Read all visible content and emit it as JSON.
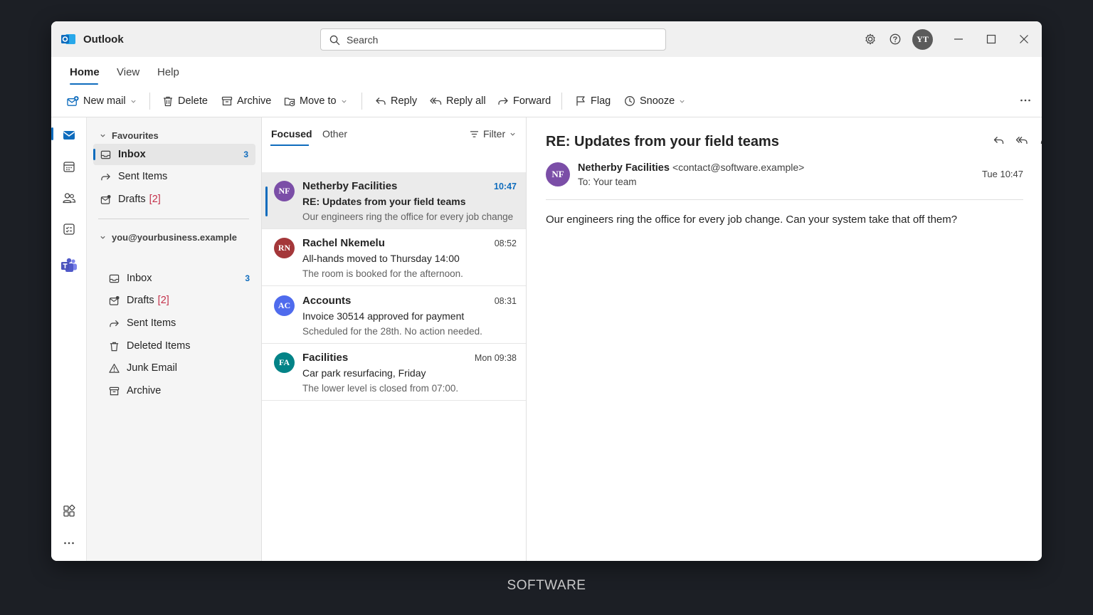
{
  "app": {
    "name": "Outlook",
    "user_initials": "YT",
    "accent_color": "#0f6cbd"
  },
  "search": {
    "placeholder": "Search"
  },
  "ribbon": {
    "tabs": [
      {
        "label": "Home",
        "active": true
      },
      {
        "label": "View",
        "active": false
      },
      {
        "label": "Help",
        "active": false
      }
    ],
    "commands": {
      "new_mail": "New mail",
      "delete": "Delete",
      "archive": "Archive",
      "move_to": "Move to",
      "reply": "Reply",
      "reply_all": "Reply all",
      "forward": "Forward",
      "flag": "Flag",
      "snooze": "Snooze"
    }
  },
  "folders": {
    "favourites": {
      "title": "Favourites",
      "items": [
        {
          "label": "Inbox",
          "count": "3",
          "icon": "inbox-icon",
          "selected": true
        },
        {
          "label": "Sent Items",
          "icon": "send-icon"
        },
        {
          "label": "Drafts",
          "bracket": "[2]",
          "icon": "drafts-icon"
        }
      ]
    },
    "account": {
      "title": "you@yourbusiness.example",
      "items": [
        {
          "label": "Inbox",
          "count": "3",
          "icon": "inbox-icon"
        },
        {
          "label": "Drafts",
          "bracket": "[2]",
          "icon": "drafts-icon"
        },
        {
          "label": "Sent Items",
          "icon": "send-icon"
        },
        {
          "label": "Deleted Items",
          "icon": "trash-icon"
        },
        {
          "label": "Junk Email",
          "icon": "warning-icon"
        },
        {
          "label": "Archive",
          "icon": "archive-icon"
        }
      ]
    }
  },
  "message_list": {
    "tabs": {
      "focused": "Focused",
      "other": "Other"
    },
    "filter_label": "Filter",
    "messages": [
      {
        "initials": "NF",
        "avatar_color": "#7b4ea7",
        "sender": "Netherby Facilities",
        "time": "10:47",
        "subject": "RE: Updates from your field teams",
        "preview": "Our engineers ring the office for every job change. Can your system take that off them?",
        "selected": true,
        "unread": true
      },
      {
        "initials": "RN",
        "avatar_color": "#a4373a",
        "sender": "Rachel Nkemelu",
        "time": "08:52",
        "subject": "All-hands moved to Thursday 14:00",
        "preview": "The room is booked for the afternoon."
      },
      {
        "initials": "AC",
        "avatar_color": "#4f6bed",
        "sender": "Accounts",
        "time": "08:31",
        "subject": "Invoice 30514 approved for payment",
        "preview": "Scheduled for the 28th. No action needed."
      },
      {
        "initials": "FA",
        "avatar_color": "#038387",
        "sender": "Facilities",
        "time": "Mon 09:38",
        "subject": "Car park resurfacing, Friday",
        "preview": "The lower level is closed from 07:00."
      }
    ]
  },
  "reading_pane": {
    "subject": "RE: Updates from your field teams",
    "sender_initials": "NF",
    "sender_name": "Netherby Facilities",
    "sender_email": "<contact@software.example>",
    "to": "To: Your team",
    "date": "Tue 10:47",
    "body": "Our engineers ring the office for every job change. Can your system take that off them?"
  },
  "caption": "SOFTWARE"
}
